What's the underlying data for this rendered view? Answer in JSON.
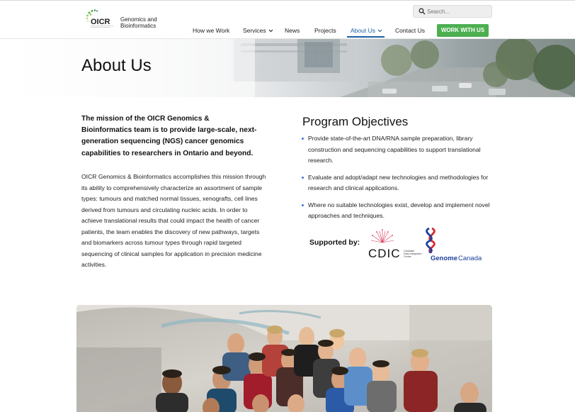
{
  "header": {
    "logo": {
      "brand_mark": "OICR",
      "text_line1": "Genomics and",
      "text_line2": "Bioinformatics"
    },
    "search": {
      "placeholder": "Search..."
    },
    "nav": {
      "items": [
        {
          "label": "How we Work",
          "has_dropdown": false,
          "active": false
        },
        {
          "label": "Services",
          "has_dropdown": true,
          "active": false
        },
        {
          "label": "News",
          "has_dropdown": false,
          "active": false
        },
        {
          "label": "Projects",
          "has_dropdown": false,
          "active": false
        },
        {
          "label": "About Us",
          "has_dropdown": true,
          "active": true
        },
        {
          "label": "Contact Us",
          "has_dropdown": false,
          "active": false
        }
      ],
      "cta": "WORK WITH US"
    }
  },
  "hero": {
    "title": "About Us"
  },
  "main": {
    "mission_statement": "The mission of the OICR Genomics & Bioinformatics team is to provide large-scale, next-generation sequencing (NGS) cancer genomics capabilities to researchers in Ontario and beyond.",
    "body_paragraph": "OICR Genomics & Bioinformatics accomplishes this mission through its ability to comprehensively characterize an assortment of sample types: tumours and matched normal tissues, xenografts, cell lines derived from tumours and circulating nucleic acids. In order to achieve translational results that could impact the health of cancer patients, the team enables the discovery of new pathways, targets and biomarkers across tumour types through rapid targeted sequencing of clinical samples for application in precision medicine activities.",
    "objectives": {
      "title": "Program Objectives",
      "items": [
        "Provide state-of-the-art DNA/RNA sample preparation, library construction and sequencing capabilities to support translational research.",
        "Evaluate and adopt/adapt new technologies and methodologies for research and clinical applications.",
        "Where no suitable technologies exist, develop and implement novel approaches and techniques."
      ]
    },
    "supported_by": {
      "label": "Supported by:",
      "cdic": {
        "name": "CDIC",
        "subtext_line1": "Canadian",
        "subtext_line2": "Data Integration",
        "subtext_line3": "Centre"
      },
      "genome_canada": {
        "name_part1": "Genome",
        "name_part2": "Canada"
      }
    }
  },
  "colors": {
    "accent_blue": "#1a5fa3",
    "cta_green": "#4caf50",
    "bullet_blue": "#3a7bd5"
  },
  "icons": [
    "search-icon",
    "chevron-down-icon"
  ]
}
